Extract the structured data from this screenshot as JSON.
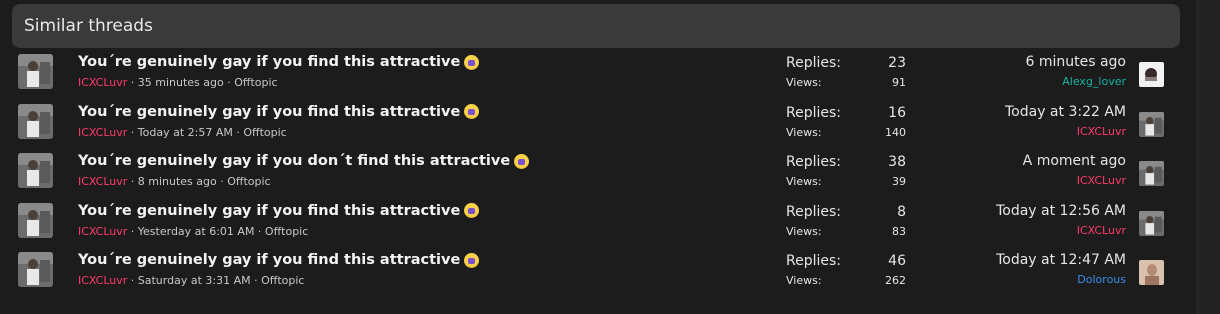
{
  "header": {
    "title": "Similar threads"
  },
  "colors": {
    "user_red": "#ff3b6b",
    "user_teal": "#18b3a3",
    "user_blue": "#3b8de8"
  },
  "labels": {
    "replies": "Replies:",
    "views": "Views:"
  },
  "threads": [
    {
      "title": "You´re genuinely gay if you find this attractive",
      "author": "ICXCLuvr",
      "meta_rest": " · 35 minutes ago · Offtopic",
      "replies": "23",
      "views": "91",
      "last_time": "6 minutes ago",
      "last_user": "Alexg_lover",
      "last_user_color": "teal",
      "last_avatar": "cartoon-avatar"
    },
    {
      "title": "You´re genuinely gay if you find this attractive",
      "author": "ICXCLuvr",
      "meta_rest": " · Today at 2:57 AM · Offtopic",
      "replies": "16",
      "views": "140",
      "last_time": "Today at 3:22 AM",
      "last_user": "ICXCLuvr",
      "last_user_color": "red",
      "last_avatar": "photo-avatar"
    },
    {
      "title": "You´re genuinely gay if you don´t find this attractive",
      "author": "ICXCLuvr",
      "meta_rest": " · 8 minutes ago · Offtopic",
      "replies": "38",
      "views": "39",
      "last_time": "A moment ago",
      "last_user": "ICXCLuvr",
      "last_user_color": "red",
      "last_avatar": "photo-avatar"
    },
    {
      "title": "You´re genuinely gay if you find this attractive",
      "author": "ICXCLuvr",
      "meta_rest": " · Yesterday at 6:01 AM · Offtopic",
      "replies": "8",
      "views": "83",
      "last_time": "Today at 12:56 AM",
      "last_user": "ICXCLuvr",
      "last_user_color": "red",
      "last_avatar": "photo-avatar"
    },
    {
      "title": "You´re genuinely gay if you find this attractive",
      "author": "ICXCLuvr",
      "meta_rest": " · Saturday at 3:31 AM · Offtopic",
      "replies": "46",
      "views": "262",
      "last_time": "Today at 12:47 AM",
      "last_user": "Dolorous",
      "last_user_color": "blue",
      "last_avatar": "portrait-avatar"
    }
  ]
}
